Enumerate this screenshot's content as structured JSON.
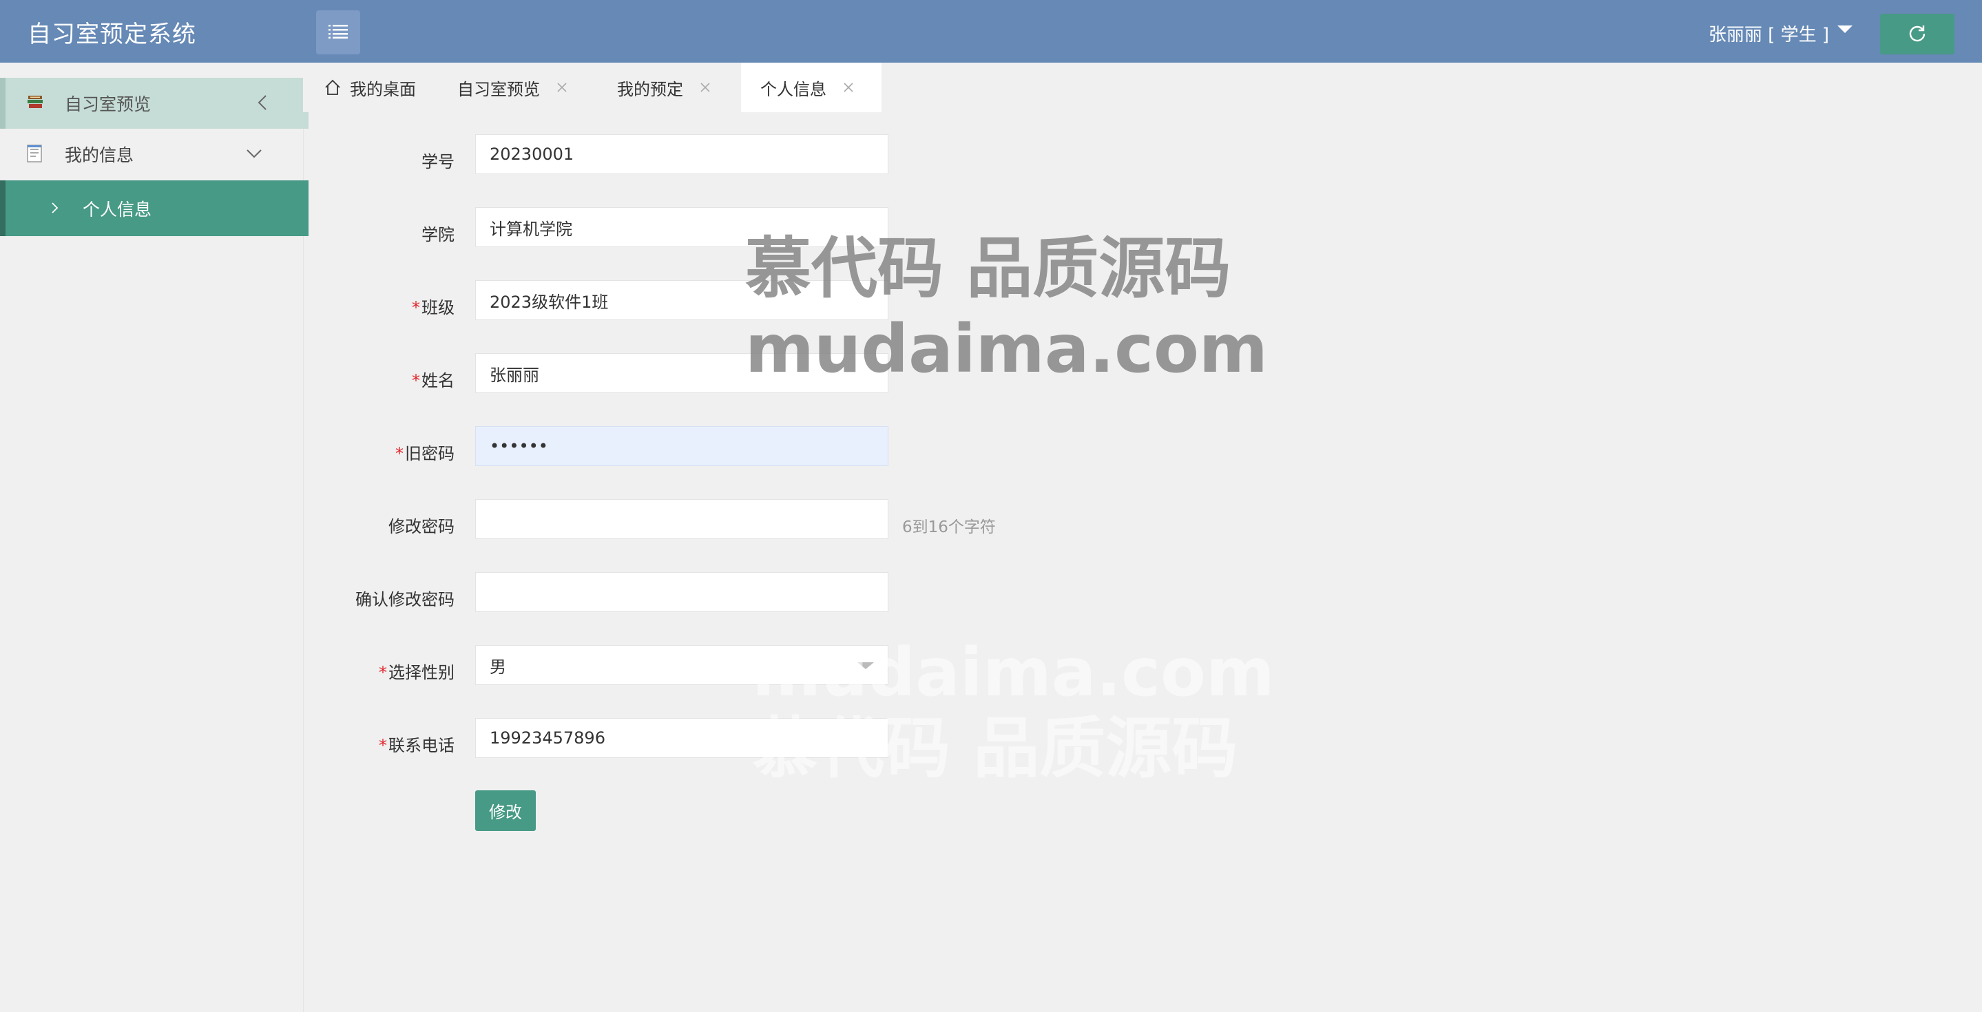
{
  "header": {
    "app_title": "自习室预定系统",
    "user_label": "张丽丽 [ 学生 ]"
  },
  "sidebar": {
    "items": [
      {
        "label": "自习室预览",
        "icon": "books-icon",
        "chevron": "chevron-left-icon"
      },
      {
        "label": "我的信息",
        "icon": "document-icon",
        "chevron": "chevron-down-icon"
      },
      {
        "label": "个人信息",
        "icon": "chevron-right-icon",
        "active": true
      }
    ]
  },
  "tabs": [
    {
      "label": "我的桌面",
      "icon": "home-icon",
      "closable": false
    },
    {
      "label": "自习室预览",
      "closable": true
    },
    {
      "label": "我的预定",
      "closable": true
    },
    {
      "label": "个人信息",
      "closable": true,
      "active": true
    }
  ],
  "form": {
    "student_id": {
      "label": "学号",
      "value": "20230001"
    },
    "college": {
      "label": "学院",
      "value": "计算机学院"
    },
    "class": {
      "label": "班级",
      "value": "2023级软件1班",
      "required_mark": "*"
    },
    "name": {
      "label": "姓名",
      "value": "张丽丽",
      "required_mark": "*"
    },
    "old_password": {
      "label": "旧密码",
      "value": "••••••",
      "required_mark": "*"
    },
    "new_password": {
      "label": "修改密码",
      "value": "",
      "hint": "6到16个字符"
    },
    "confirm_password": {
      "label": "确认修改密码",
      "value": ""
    },
    "gender": {
      "label": "选择性别",
      "value": "男",
      "required_mark": "*"
    },
    "phone": {
      "label": "联系电话",
      "value": "19923457896",
      "required_mark": "*"
    },
    "submit_label": "修改"
  },
  "watermark": {
    "line1": "慕代码 品质源码",
    "line2": "mudaima.com"
  },
  "colors": {
    "header_bg": "#6689b6",
    "accent": "#479a85",
    "required": "#e0242a"
  }
}
